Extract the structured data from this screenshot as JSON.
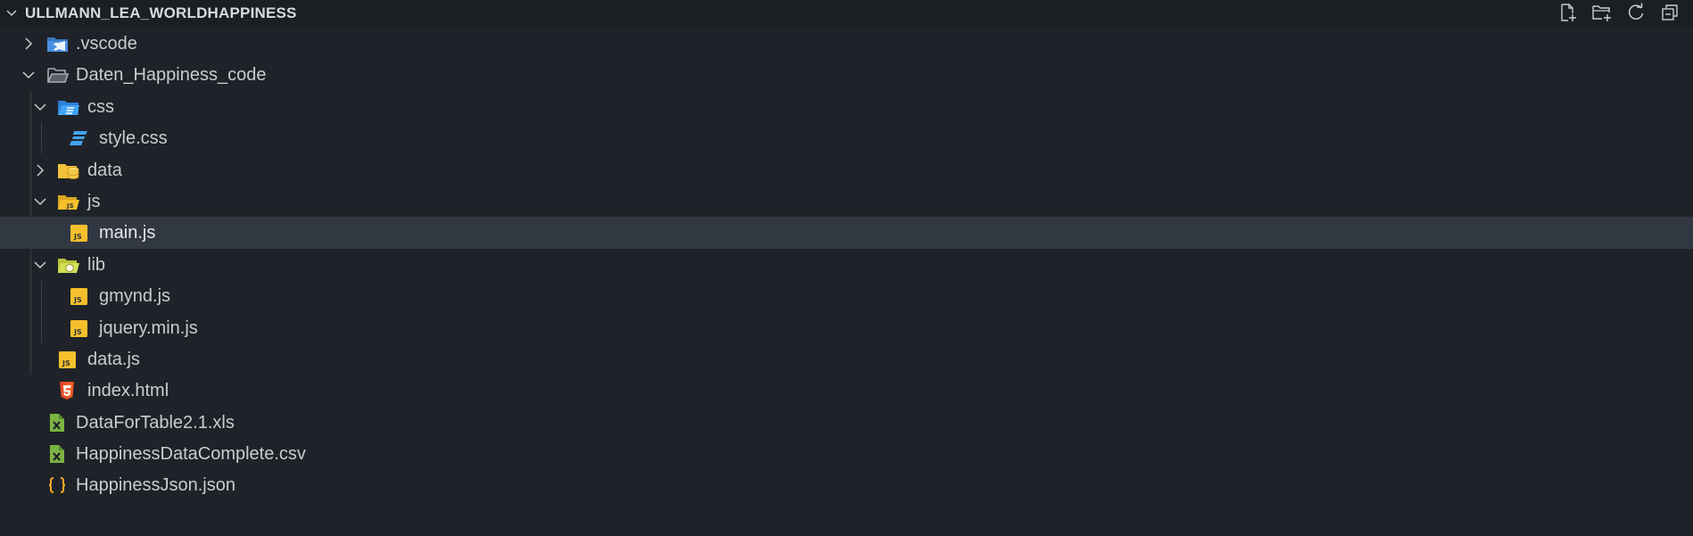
{
  "explorer": {
    "title": "ULLMANN_LEA_WORLDHAPPINESS",
    "actions": [
      {
        "name": "new-file-icon"
      },
      {
        "name": "new-folder-icon"
      },
      {
        "name": "refresh-icon"
      },
      {
        "name": "collapse-all-icon"
      }
    ]
  },
  "tree": [
    {
      "label": ".vscode",
      "type": "folder",
      "icon": "vscode-folder-icon",
      "expanded": false,
      "depth": 0
    },
    {
      "label": "Daten_Happiness_code",
      "type": "folder",
      "icon": "folder-open-icon",
      "expanded": true,
      "depth": 0
    },
    {
      "label": "css",
      "type": "folder",
      "icon": "css-folder-icon",
      "expanded": true,
      "depth": 1
    },
    {
      "label": "style.css",
      "type": "file",
      "icon": "css-file-icon",
      "depth": 2
    },
    {
      "label": "data",
      "type": "folder",
      "icon": "data-folder-icon",
      "expanded": false,
      "depth": 1
    },
    {
      "label": "js",
      "type": "folder",
      "icon": "js-folder-icon",
      "expanded": true,
      "depth": 1
    },
    {
      "label": "main.js",
      "type": "file",
      "icon": "js-file-icon",
      "depth": 2,
      "selected": true
    },
    {
      "label": "lib",
      "type": "folder",
      "icon": "lib-folder-icon",
      "expanded": true,
      "depth": 1
    },
    {
      "label": "gmynd.js",
      "type": "file",
      "icon": "js-file-icon",
      "depth": 2
    },
    {
      "label": "jquery.min.js",
      "type": "file",
      "icon": "js-file-icon",
      "depth": 2
    },
    {
      "label": "data.js",
      "type": "file",
      "icon": "js-file-icon",
      "depth": 1
    },
    {
      "label": "index.html",
      "type": "file",
      "icon": "html-file-icon",
      "depth": 1
    },
    {
      "label": "DataForTable2.1.xls",
      "type": "file",
      "icon": "excel-file-icon",
      "depth": 0
    },
    {
      "label": "HappinessDataComplete.csv",
      "type": "file",
      "icon": "csv-file-icon",
      "depth": 0
    },
    {
      "label": "HappinessJson.json",
      "type": "file",
      "icon": "json-file-icon",
      "depth": 0
    }
  ],
  "colors": {
    "background": "#1f2329",
    "selected_row": "#323842",
    "js_yellow": "#f5c02c",
    "css_blue": "#42a5f5",
    "html_orange": "#e44d26",
    "excel_green": "#7cb342",
    "json_orange": "#f9a825",
    "folder_yellow": "#f3c13a"
  }
}
